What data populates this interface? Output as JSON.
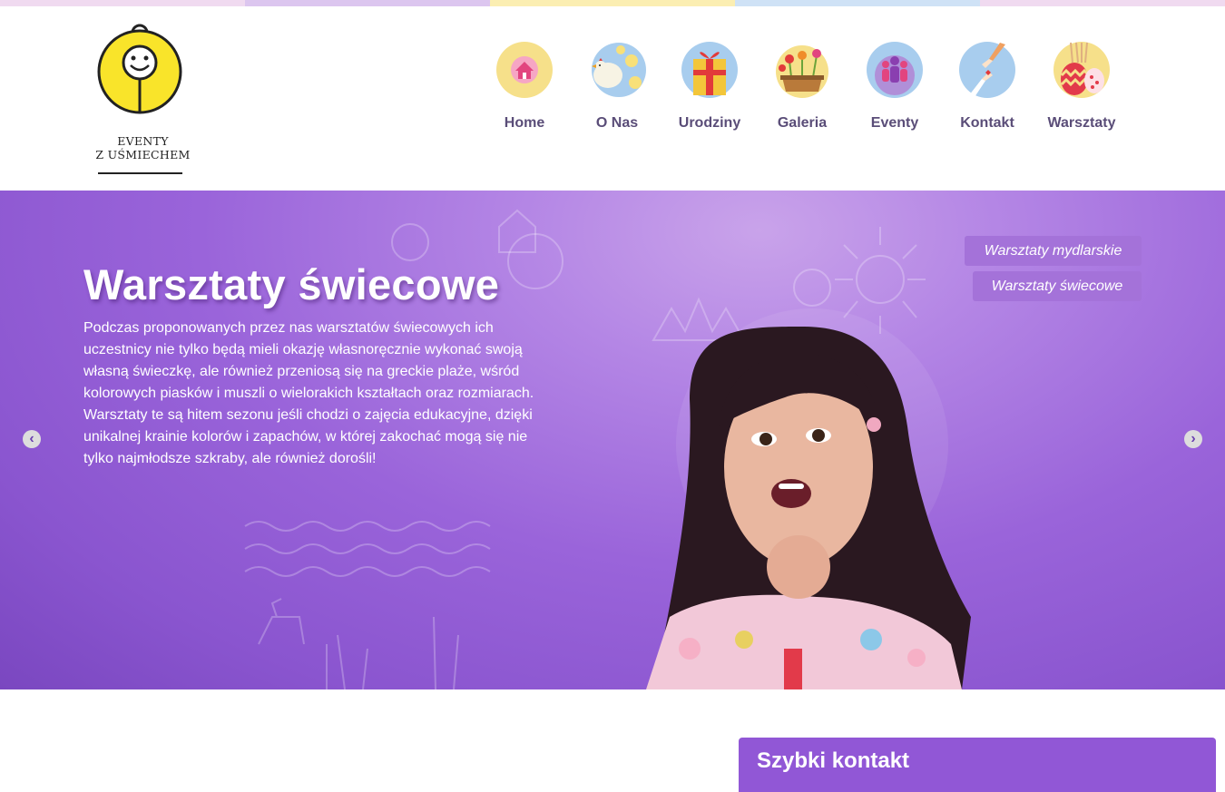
{
  "colors": {
    "strip": [
      "#f0daf0",
      "#dcc6ef",
      "#fbeeb2",
      "#cfe2f6",
      "#f0daf0"
    ],
    "nav_text": "#5a4d78",
    "hero_purple": "#9a64da",
    "button_purple": "#a472d9",
    "contact_purple": "#9157d6"
  },
  "logo": {
    "line1": "EVENTY",
    "line2": "Z UŚMIECHEM"
  },
  "nav": {
    "items": [
      {
        "label": "Home",
        "icon": "home-icon"
      },
      {
        "label": "O Nas",
        "icon": "chickens-icon"
      },
      {
        "label": "Urodziny",
        "icon": "gift-icon"
      },
      {
        "label": "Galeria",
        "icon": "flowers-icon"
      },
      {
        "label": "Eventy",
        "icon": "people-icon"
      },
      {
        "label": "Kontakt",
        "icon": "hands-icon"
      },
      {
        "label": "Warsztaty",
        "icon": "easter-eggs-icon"
      }
    ]
  },
  "hero": {
    "title": "Warsztaty świecowe",
    "text": "Podczas proponowanych przez nas warsztatów świecowych ich uczestnicy nie tylko będą mieli okazję własnoręcznie wykonać swoją własną świeczkę, ale również przeniosą się na greckie plaże, wśród kolorowych piasków i muszli o wielorakich kształtach oraz rozmiarach. Warsztaty te są hitem sezonu jeśli chodzi o zajęcia edukacyjne, dzięki unikalnej krainie kolorów i zapachów, w której zakochać mogą się nie tylko najmłodsze szkraby, ale również dorośli!",
    "buttons": [
      "Warsztaty mydlarskie",
      "Warsztaty świecowe"
    ],
    "prev_icon": "chevron-left-icon",
    "next_icon": "chevron-right-icon"
  },
  "contact": {
    "title": "Szybki kontakt"
  }
}
